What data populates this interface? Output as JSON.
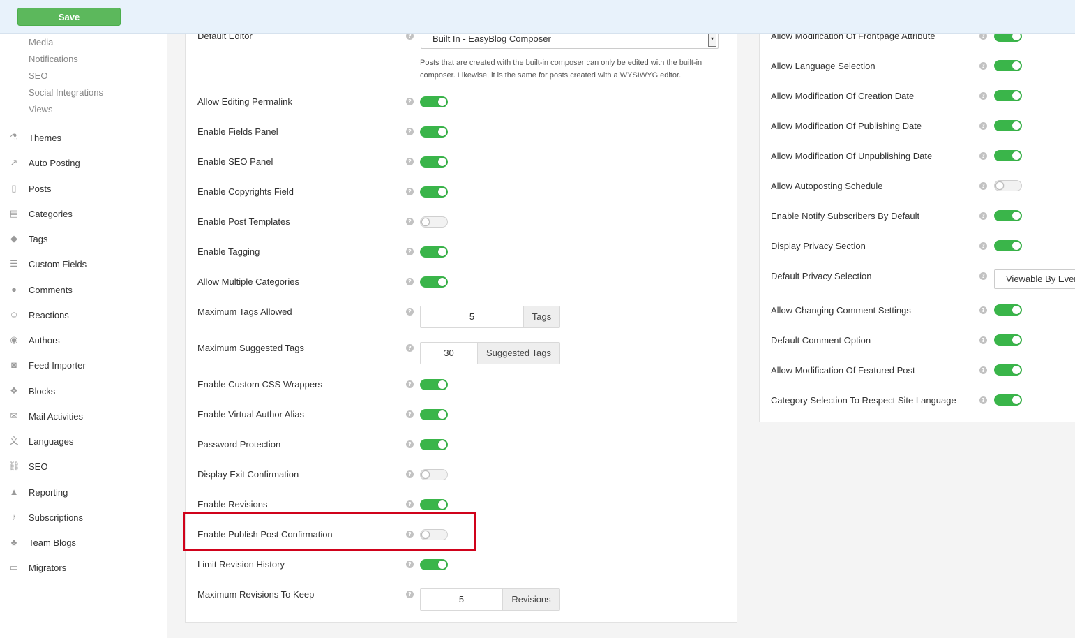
{
  "toolbar": {
    "save_label": "Save"
  },
  "sidebar": {
    "sub_items": [
      "Media",
      "Notifications",
      "SEO",
      "Social Integrations",
      "Views"
    ],
    "items": [
      {
        "label": "Themes",
        "icon": "flask-icon"
      },
      {
        "label": "Auto Posting",
        "icon": "share-icon"
      },
      {
        "label": "Posts",
        "icon": "file-icon"
      },
      {
        "label": "Categories",
        "icon": "archive-icon"
      },
      {
        "label": "Tags",
        "icon": "tags-icon"
      },
      {
        "label": "Custom Fields",
        "icon": "list-icon"
      },
      {
        "label": "Comments",
        "icon": "comments-icon"
      },
      {
        "label": "Reactions",
        "icon": "smile-icon"
      },
      {
        "label": "Authors",
        "icon": "user-circle-icon"
      },
      {
        "label": "Feed Importer",
        "icon": "rss-icon"
      },
      {
        "label": "Blocks",
        "icon": "cubes-icon"
      },
      {
        "label": "Mail Activities",
        "icon": "envelope-icon"
      },
      {
        "label": "Languages",
        "icon": "language-icon"
      },
      {
        "label": "SEO",
        "icon": "unlink-icon"
      },
      {
        "label": "Reporting",
        "icon": "warning-icon"
      },
      {
        "label": "Subscriptions",
        "icon": "bell-icon"
      },
      {
        "label": "Team Blogs",
        "icon": "users-icon"
      },
      {
        "label": "Migrators",
        "icon": "laptop-icon"
      }
    ]
  },
  "left_settings": {
    "default_editor": {
      "label": "Default Editor",
      "value": "Built In - EasyBlog Composer",
      "note_line1": "Posts that are created with the built-in composer can only be edited with the built-in",
      "note_line2": "composer. Likewise, it is the same for posts created with a WYSIWYG editor."
    },
    "rows": [
      {
        "label": "Allow Editing Permalink",
        "type": "toggle",
        "on": true
      },
      {
        "label": "Enable Fields Panel",
        "type": "toggle",
        "on": true
      },
      {
        "label": "Enable SEO Panel",
        "type": "toggle",
        "on": true
      },
      {
        "label": "Enable Copyrights Field",
        "type": "toggle",
        "on": true
      },
      {
        "label": "Enable Post Templates",
        "type": "toggle",
        "on": false
      },
      {
        "label": "Enable Tagging",
        "type": "toggle",
        "on": true
      },
      {
        "label": "Allow Multiple Categories",
        "type": "toggle",
        "on": true
      },
      {
        "label": "Maximum Tags Allowed",
        "type": "input",
        "value": "5",
        "addon": "Tags"
      },
      {
        "label": "Maximum Suggested Tags",
        "type": "input",
        "value": "30",
        "addon": "Suggested Tags"
      },
      {
        "label": "Enable Custom CSS Wrappers",
        "type": "toggle",
        "on": true
      },
      {
        "label": "Enable Virtual Author Alias",
        "type": "toggle",
        "on": true
      },
      {
        "label": "Password Protection",
        "type": "toggle",
        "on": true
      },
      {
        "label": "Display Exit Confirmation",
        "type": "toggle",
        "on": false
      },
      {
        "label": "Enable Revisions",
        "type": "toggle",
        "on": true
      },
      {
        "label": "Enable Publish Post Confirmation",
        "type": "toggle",
        "on": false
      },
      {
        "label": "Limit Revision History",
        "type": "toggle",
        "on": true
      },
      {
        "label": "Maximum Revisions To Keep",
        "type": "input",
        "value": "5",
        "addon": "Revisions"
      }
    ]
  },
  "right_settings": {
    "rows": [
      {
        "label": "Allow Modification Of Frontpage Attribute",
        "type": "toggle",
        "on": true
      },
      {
        "label": "Allow Language Selection",
        "type": "toggle",
        "on": true
      },
      {
        "label": "Allow Modification Of Creation Date",
        "type": "toggle",
        "on": true
      },
      {
        "label": "Allow Modification Of Publishing Date",
        "type": "toggle",
        "on": true
      },
      {
        "label": "Allow Modification Of Unpublishing Date",
        "type": "toggle",
        "on": true
      },
      {
        "label": "Allow Autoposting Schedule",
        "type": "toggle",
        "on": false
      },
      {
        "label": "Enable Notify Subscribers By Default",
        "type": "toggle",
        "on": true
      },
      {
        "label": "Display Privacy Section",
        "type": "toggle",
        "on": true
      },
      {
        "label": "Default Privacy Selection",
        "type": "select",
        "value": "Viewable By Everyone"
      },
      {
        "label": "Allow Changing Comment Settings",
        "type": "toggle",
        "on": true
      },
      {
        "label": "Default Comment Option",
        "type": "toggle",
        "on": true
      },
      {
        "label": "Allow Modification Of Featured Post",
        "type": "toggle",
        "on": true
      },
      {
        "label": "Category Selection To Respect Site Language",
        "type": "toggle",
        "on": true
      }
    ]
  },
  "colors": {
    "toggle_on": "#3ab54a",
    "save": "#5cb85c",
    "highlight": "#d0021b"
  }
}
